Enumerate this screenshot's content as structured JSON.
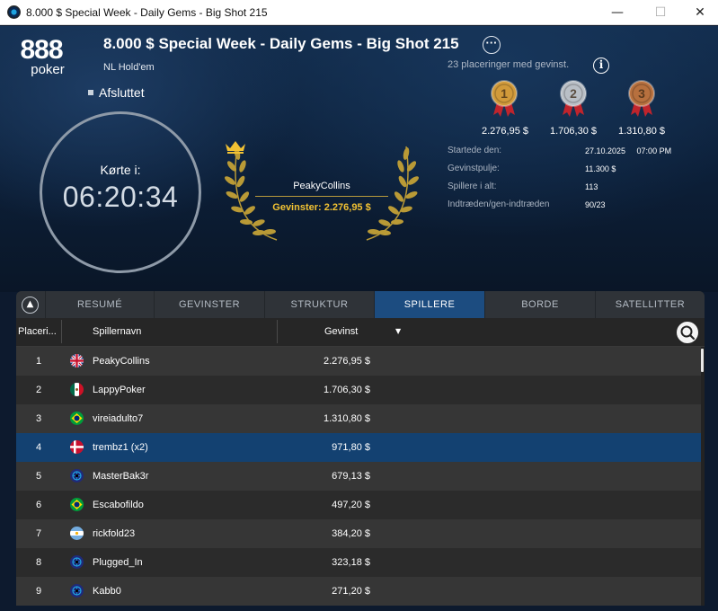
{
  "window": {
    "title": "8.000 $ Special Week - Daily Gems - Big Shot 215",
    "minimize": "—",
    "maximize": "☐",
    "close": "✕"
  },
  "logo": {
    "top": "888",
    "bottom": "poker"
  },
  "tournament": {
    "name": "8.000 $ Special Week - Daily Gems - Big Shot 215",
    "game": "NL Hold'em",
    "status": "Afsluttet",
    "more": "···"
  },
  "clock": {
    "label": "Kørte i:",
    "time": "06:20:34"
  },
  "winner": {
    "name": "PeakyCollins",
    "prize": "Gevinster: 2.276,95 $"
  },
  "payouts": {
    "text": "23 placeringer med gevinst.",
    "medals": [
      {
        "place": "1",
        "amount": "2.276,95 $",
        "color": "#d19a3a"
      },
      {
        "place": "2",
        "amount": "1.706,30 $",
        "color": "#b9bfc6"
      },
      {
        "place": "3",
        "amount": "1.310,80 $",
        "color": "#b7703e"
      }
    ]
  },
  "details": [
    {
      "label": "Startede den:",
      "value": "27.10.2025     07:00 PM"
    },
    {
      "label": "Gevinstpulje:",
      "value": "11.300 $"
    },
    {
      "label": "Spillere i alt:",
      "value": "113"
    },
    {
      "label": "Indtræden/gen-indtræden",
      "value": "90/23"
    }
  ],
  "tabs": [
    {
      "label": "RESUMÉ",
      "active": false
    },
    {
      "label": "GEVINSTER",
      "active": false
    },
    {
      "label": "STRUKTUR",
      "active": false
    },
    {
      "label": "SPILLERE",
      "active": true
    },
    {
      "label": "BORDE",
      "active": false
    },
    {
      "label": "SATELLITTER",
      "active": false
    }
  ],
  "table": {
    "headers": {
      "place": "Placeri...",
      "name": "Spillernavn",
      "prize": "Gevinst"
    },
    "rows": [
      {
        "place": "1",
        "name": "PeakyCollins",
        "prize": "2.276,95 $",
        "flag": "gb"
      },
      {
        "place": "2",
        "name": "LappyPoker",
        "prize": "1.706,30 $",
        "flag": "mx"
      },
      {
        "place": "3",
        "name": "vireiadulto7",
        "prize": "1.310,80 $",
        "flag": "br"
      },
      {
        "place": "4",
        "name": "trembz1 (x2)",
        "prize": "971,80 $",
        "flag": "dk",
        "selected": true
      },
      {
        "place": "5",
        "name": "MasterBak3r",
        "prize": "679,13 $",
        "flag": "globe"
      },
      {
        "place": "6",
        "name": "Escabofildo",
        "prize": "497,20 $",
        "flag": "br"
      },
      {
        "place": "7",
        "name": "rickfold23",
        "prize": "384,20 $",
        "flag": "ar"
      },
      {
        "place": "8",
        "name": "Plugged_In",
        "prize": "323,18 $",
        "flag": "globe"
      },
      {
        "place": "9",
        "name": "Kabb0",
        "prize": "271,20 $",
        "flag": "globe"
      }
    ]
  }
}
